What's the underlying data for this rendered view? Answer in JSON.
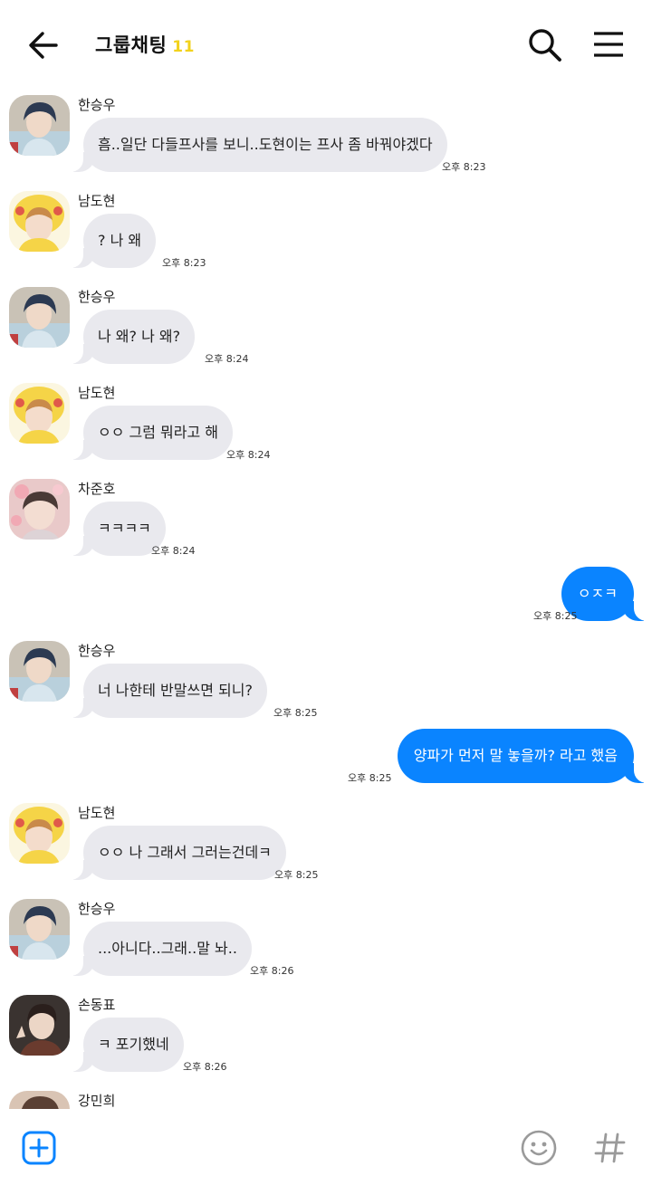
{
  "header": {
    "title": "그룹채팅",
    "member_count": "11",
    "back_icon": "arrow-left-icon",
    "search_icon": "search-icon",
    "menu_icon": "hamburger-menu-icon"
  },
  "messages": [
    {
      "sender": "한승우",
      "text": "흠..일단 다들프사를 보니..도현이는 프사 좀 바꿔야겠다",
      "time": "오후 8:23"
    },
    {
      "sender": "남도현",
      "text": "? 나 왜",
      "time": "오후 8:23"
    },
    {
      "sender": "한승우",
      "text": "나 왜? 나 왜?",
      "time": "오후 8:24"
    },
    {
      "sender": "남도현",
      "text": "ㅇㅇ 그럼 뭐라고 해",
      "time": "오후 8:24"
    },
    {
      "sender": "차준호",
      "text": "ㅋㅋㅋㅋ",
      "time": "오후 8:24"
    },
    {
      "sender": "me",
      "text": "ㅇㅈㅋ",
      "time": "오후 8:25"
    },
    {
      "sender": "한승우",
      "text": "너 나한테 반말쓰면 되니?",
      "time": "오후 8:25"
    },
    {
      "sender": "me",
      "text": "양파가 먼저 말 놓을까? 라고 했음",
      "time": "오후 8:25"
    },
    {
      "sender": "남도현",
      "text": "ㅇㅇ 나 그래서 그러는건데ㅋ",
      "time": "오후 8:25"
    },
    {
      "sender": "한승우",
      "text": "...아니다..그래..말 놔..",
      "time": "오후 8:26"
    },
    {
      "sender": "손동표",
      "text": "ㅋ 포기했네",
      "time": "오후 8:26"
    },
    {
      "sender": "강민희",
      "text": "",
      "time": ""
    }
  ],
  "footer": {
    "plus_icon": "plus-square-icon",
    "emoji_icon": "smiley-icon",
    "hash_icon": "hashtag-icon"
  },
  "colors": {
    "accent": "#0a84ff",
    "bubble_other": "#e9e9ee",
    "member_count": "#f2d21c"
  }
}
